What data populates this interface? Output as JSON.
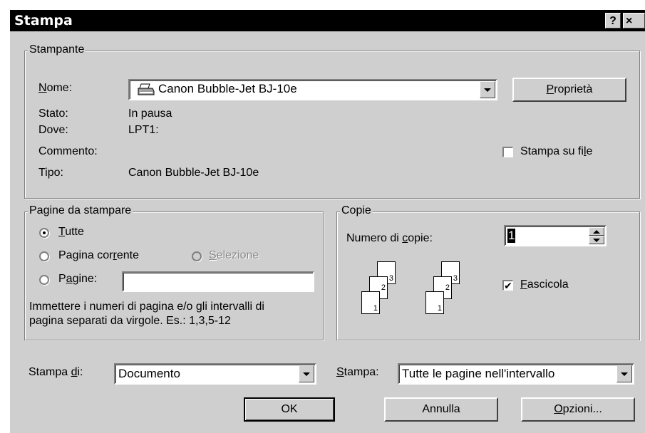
{
  "window": {
    "title": "Stampa",
    "help_glyph": "?",
    "close_glyph": "×"
  },
  "printer": {
    "group_label": "Stampante",
    "name_label": {
      "pre": "",
      "ul": "N",
      "post": "ome:"
    },
    "name_value": "Canon Bubble-Jet BJ-10e",
    "properties_button": {
      "pre": "",
      "ul": "P",
      "post": "roprietà"
    },
    "status_label": "Stato:",
    "status_value": "In pausa",
    "where_label": "Dove:",
    "where_value": "LPT1:",
    "comment_label": "Commento:",
    "comment_value": "",
    "type_label": "Tipo:",
    "type_value": "Canon Bubble-Jet BJ-10e",
    "print_to_file": {
      "pre": "Stampa su fi",
      "ul": "l",
      "post": "e",
      "checked": false
    }
  },
  "range": {
    "group_label": "Pagine da stampare",
    "all": {
      "pre": "",
      "ul": "T",
      "post": "utte",
      "selected": true
    },
    "current": {
      "pre": "Pagina cor",
      "ul": "r",
      "post": "ente",
      "selected": false
    },
    "selection": {
      "pre": "",
      "ul": "S",
      "post": "elezione",
      "enabled": false
    },
    "pages": {
      "pre": "P",
      "ul": "a",
      "post": "gine:",
      "selected": false,
      "value": ""
    },
    "hint_line1": "Immettere i numeri di pagina e/o gli intervalli di",
    "hint_line2": "pagina separati da virgole. Es.: 1,3,5-12"
  },
  "copies": {
    "group_label": "Copie",
    "number_label": {
      "pre": "Numero di ",
      "ul": "c",
      "post": "opie:"
    },
    "number_value": "1",
    "collate": {
      "pre": "",
      "ul": "F",
      "post": "ascicola",
      "checked": true
    },
    "page_numbers": [
      "1",
      "2",
      "3"
    ]
  },
  "bottom": {
    "print_what_label": {
      "pre": "Stampa ",
      "ul": "d",
      "post": "i:"
    },
    "print_what_value": "Documento",
    "print_label": {
      "pre": "",
      "ul": "S",
      "post": "tampa:"
    },
    "print_value": "Tutte le pagine nell'intervallo",
    "ok_button": "OK",
    "cancel_button": "Annulla",
    "options_button": {
      "pre": "",
      "ul": "O",
      "post": "pzioni..."
    }
  },
  "icons": {
    "printer": "printer-icon",
    "check": "✔"
  }
}
